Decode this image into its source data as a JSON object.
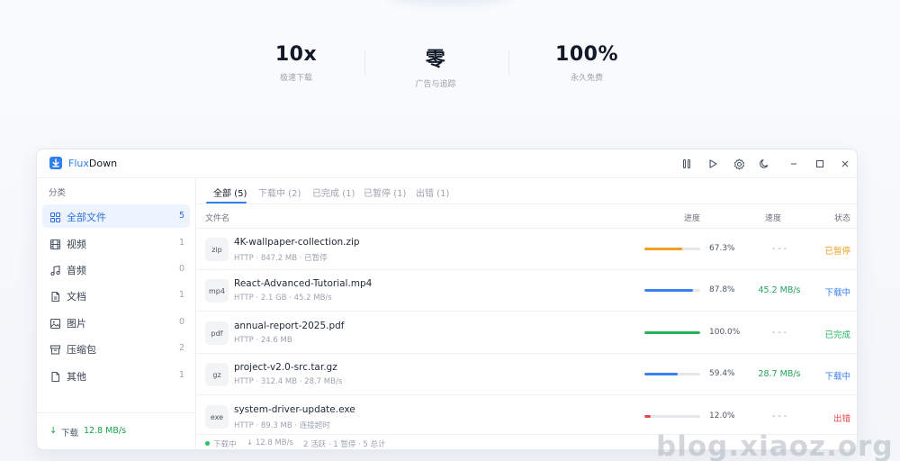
{
  "stats": [
    {
      "value": "10x",
      "label": "极速下载"
    },
    {
      "value": "零",
      "label": "广告与追踪"
    },
    {
      "value": "100%",
      "label": "永久免费"
    }
  ],
  "app": {
    "name_accent": "Flux",
    "name_rest": "Down",
    "icons": [
      "pause-all-icon",
      "start-all-icon",
      "settings-icon",
      "dark-mode-icon",
      "minimize-icon",
      "maximize-icon",
      "close-icon"
    ]
  },
  "sidebar": {
    "title": "分类",
    "items": [
      {
        "label": "全部文件",
        "count": "5",
        "icon": "grid-icon"
      },
      {
        "label": "视频",
        "count": "1",
        "icon": "film-icon"
      },
      {
        "label": "音频",
        "count": "0",
        "icon": "music-icon"
      },
      {
        "label": "文档",
        "count": "1",
        "icon": "document-icon"
      },
      {
        "label": "图片",
        "count": "0",
        "icon": "image-icon"
      },
      {
        "label": "压缩包",
        "count": "2",
        "icon": "archive-icon"
      },
      {
        "label": "其他",
        "count": "1",
        "icon": "file-icon"
      }
    ],
    "footer": {
      "arrow": "↓",
      "label": "下载",
      "speed": "12.8 MB/s"
    }
  },
  "tabs": [
    {
      "label": "全部 (5)"
    },
    {
      "label": "下载中 (2)"
    },
    {
      "label": "已完成 (1)"
    },
    {
      "label": "已暂停 (1)"
    },
    {
      "label": "出错 (1)"
    }
  ],
  "columns": {
    "name": "文件名",
    "progress": "进度",
    "speed": "速度",
    "status": "状态"
  },
  "downloads": [
    {
      "type": "zip",
      "name": "4K-wallpaper-collection.zip",
      "meta": "HTTP · 847.2 MB · 已暂停",
      "progress": 67.3,
      "progress_label": "67.3%",
      "speed": "- - -",
      "status": "已暂停",
      "color": "#f0a020"
    },
    {
      "type": "mp4",
      "name": "React-Advanced-Tutorial.mp4",
      "meta": "HTTP · 2.1 GB · 45.2 MB/s",
      "progress": 87.8,
      "progress_label": "87.8%",
      "speed": "45.2 MB/s",
      "status": "下载中",
      "color": "#3b7ff0"
    },
    {
      "type": "pdf",
      "name": "annual-report-2025.pdf",
      "meta": "HTTP · 24.6 MB",
      "progress": 100.0,
      "progress_label": "100.0%",
      "speed": "- - -",
      "status": "已完成",
      "color": "#22b55a"
    },
    {
      "type": "gz",
      "name": "project-v2.0-src.tar.gz",
      "meta": "HTTP · 312.4 MB · 28.7 MB/s",
      "progress": 59.4,
      "progress_label": "59.4%",
      "speed": "28.7 MB/s",
      "status": "下载中",
      "color": "#3b7ff0"
    },
    {
      "type": "exe",
      "name": "system-driver-update.exe",
      "meta": "HTTP · 89.3 MB · 连接超时",
      "progress": 12.0,
      "progress_label": "12.0%",
      "speed": "- - -",
      "status": "出错",
      "color": "#e5484d"
    }
  ],
  "statusbar": {
    "state": "下载中",
    "speed": "↓ 12.8 MB/s",
    "summary": "2 活跃 · 1 暂停 · 5 总计"
  },
  "watermark": "blog.xiaoz.org"
}
